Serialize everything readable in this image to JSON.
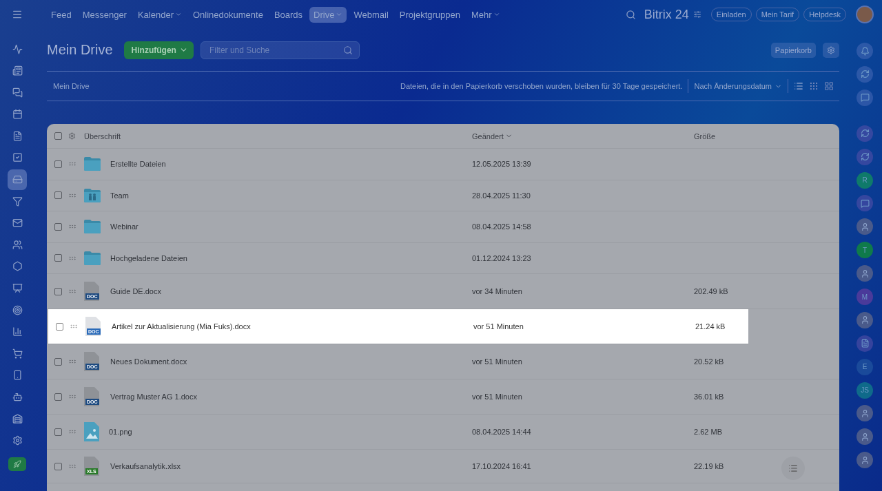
{
  "top_nav": {
    "items": [
      {
        "label": "Feed",
        "selected": false,
        "dropdown": false
      },
      {
        "label": "Messenger",
        "selected": false,
        "dropdown": false
      },
      {
        "label": "Kalender",
        "selected": false,
        "dropdown": true
      },
      {
        "label": "Onlinedokumente",
        "selected": false,
        "dropdown": false
      },
      {
        "label": "Boards",
        "selected": false,
        "dropdown": false
      },
      {
        "label": "Drive",
        "selected": true,
        "dropdown": true
      },
      {
        "label": "Webmail",
        "selected": false,
        "dropdown": false
      },
      {
        "label": "Projektgruppen",
        "selected": false,
        "dropdown": false
      },
      {
        "label": "Mehr",
        "selected": false,
        "dropdown": true
      }
    ],
    "brand": "Bitrix 24",
    "buttons": [
      "Einladen",
      "Mein Tarif",
      "Helpdesk"
    ]
  },
  "left_sidebar": {
    "items": [
      {
        "selected": false
      },
      {
        "selected": false
      },
      {
        "selected": false
      },
      {
        "selected": false
      },
      {
        "selected": false
      },
      {
        "selected": false
      },
      {
        "selected": true
      },
      {
        "selected": false
      },
      {
        "selected": false
      },
      {
        "selected": false
      },
      {
        "selected": false
      },
      {
        "selected": false
      },
      {
        "selected": false
      },
      {
        "selected": false
      },
      {
        "selected": false
      },
      {
        "selected": false
      },
      {
        "selected": false
      },
      {
        "selected": false
      },
      {
        "selected": false
      }
    ]
  },
  "header": {
    "title": "Mein Drive",
    "add_button": "Hinzufügen",
    "search": {
      "placeholder": "Filter und Suche"
    },
    "trash_button": "Papierkorb"
  },
  "toolbar": {
    "breadcrumb": "Mein Drive",
    "notice": "Dateien, die in den Papierkorb verschoben wurden, bleiben für 30 Tage gespeichert.",
    "sort": "Nach Änderungsdatum",
    "views": [
      {
        "selected": true
      },
      {
        "selected": false
      },
      {
        "selected": false
      }
    ]
  },
  "table": {
    "all_checked": false,
    "columns": [
      {
        "label": "Überschrift",
        "sorted": false
      },
      {
        "label": "Geändert",
        "sorted": true
      },
      {
        "label": "Größe",
        "sorted": false
      }
    ],
    "rows": [
      {
        "kind": "folder",
        "name": "Erstellte Dateien",
        "modified": "12.05.2025 13:39",
        "highlighted": false,
        "checked": false
      },
      {
        "kind": "team-folder",
        "name": "Team",
        "modified": "28.04.2025 11:30",
        "highlighted": false,
        "checked": false
      },
      {
        "kind": "folder",
        "name": "Webinar",
        "modified": "08.04.2025 14:58",
        "highlighted": false,
        "checked": false
      },
      {
        "kind": "folder",
        "name": "Hochgeladene Dateien",
        "modified": "01.12.2024 13:23",
        "highlighted": false,
        "checked": false
      },
      {
        "kind": "doc",
        "badge": "DOC",
        "name": "Guide DE.docx",
        "modified": "vor 34 Minuten",
        "size": "202.49 kB",
        "highlighted": false,
        "checked": false
      },
      {
        "kind": "doc",
        "badge": "DOC",
        "name": "Artikel zur Aktualisierung (Mia Fuks).docx",
        "modified": "vor 51 Minuten",
        "size": "21.24 kB",
        "highlighted": true,
        "checked": false
      },
      {
        "kind": "doc",
        "badge": "DOC",
        "name": "Neues Dokument.docx",
        "modified": "vor 51 Minuten",
        "size": "20.52 kB",
        "highlighted": false,
        "checked": false
      },
      {
        "kind": "doc",
        "badge": "DOC",
        "name": "Vertrag Muster AG 1.docx",
        "modified": "vor 51 Minuten",
        "size": "36.01 kB",
        "highlighted": false,
        "checked": false
      },
      {
        "kind": "image",
        "name": "01.png",
        "modified": "08.04.2025 14:44",
        "size": "2.62 MB",
        "highlighted": false,
        "checked": false
      },
      {
        "kind": "xls",
        "badge": "XLS",
        "name": "Verkaufsanalytik.xlsx",
        "modified": "17.10.2024 16:41",
        "size": "22.19 kB",
        "highlighted": false,
        "checked": false
      }
    ]
  },
  "right_sidebar": {
    "items": [
      {
        "kind": "icon"
      },
      {
        "kind": "icon"
      },
      {
        "kind": "icon"
      },
      {
        "kind": "icon"
      },
      {
        "kind": "icon"
      },
      {
        "kind": "letter",
        "text": "R",
        "color": "#0f7a6a"
      },
      {
        "kind": "icon"
      },
      {
        "kind": "photo"
      },
      {
        "kind": "letter",
        "text": "T",
        "color": "#0f7a4a"
      },
      {
        "kind": "photo"
      },
      {
        "kind": "letter",
        "text": "M",
        "color": "#4a3a9a"
      },
      {
        "kind": "photo"
      },
      {
        "kind": "icon"
      },
      {
        "kind": "letter",
        "text": "E",
        "color": "#1a4a9a"
      },
      {
        "kind": "letter",
        "text": "JS",
        "color": "#0f6a8a"
      },
      {
        "kind": "photo"
      },
      {
        "kind": "photo"
      },
      {
        "kind": "photo"
      }
    ]
  }
}
